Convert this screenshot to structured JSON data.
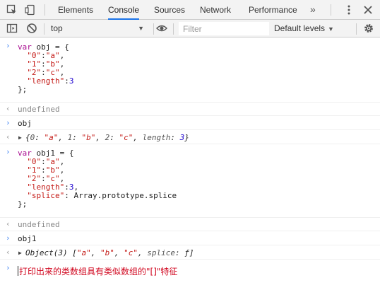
{
  "tabs": {
    "elements": "Elements",
    "console": "Console",
    "sources": "Sources",
    "network": "Network",
    "performance": "Performance",
    "more": "»"
  },
  "toolbar": {
    "context": "top",
    "filter_placeholder": "Filter",
    "levels": "Default levels"
  },
  "entries": {
    "e1": {
      "l1_kw": "var",
      "l1_rest": " obj = {",
      "l2_key": "\"0\"",
      "l2_val": "\"a\"",
      "l3_key": "\"1\"",
      "l3_val": "\"b\"",
      "l4_key": "\"2\"",
      "l4_val": "\"c\"",
      "l5_key": "\"length\"",
      "l5_val": "3",
      "l6": "};"
    },
    "r1": "undefined",
    "e2": "obj",
    "r2": {
      "open": "{",
      "k0": "0",
      "v0": "\"a\"",
      "k1": "1",
      "v1": "\"b\"",
      "k2": "2",
      "v2": "\"c\"",
      "k3": "length",
      "v3": "3",
      "close": "}"
    },
    "e3": {
      "l1_kw": "var",
      "l1_rest": " obj1 = {",
      "l2_key": "\"0\"",
      "l2_val": "\"a\"",
      "l3_key": "\"1\"",
      "l3_val": "\"b\"",
      "l4_key": "\"2\"",
      "l4_val": "\"c\"",
      "l5_key": "\"length\"",
      "l5_val": "3",
      "l6_key": "\"splice\"",
      "l6_val": " Array.prototype.splice",
      "l7": "};"
    },
    "r3": "undefined",
    "e4": "obj1",
    "r4": {
      "prefix": "Object(3) [",
      "a": "\"a\"",
      "b": "\"b\"",
      "c": "\"c\"",
      "splice_key": "splice",
      "splice_val": "ƒ",
      "close": "]"
    }
  },
  "comment": "打印出来的类数组具有类似数组的\"[]\"特征",
  "colors": {
    "keyword": "#aa0d91",
    "string": "#c41a16",
    "number": "#1c00cf",
    "active_tab": "#1a73e8",
    "comment": "#d0021b"
  },
  "icons": [
    "inspect-icon",
    "device-toggle-icon",
    "kebab-menu-icon",
    "close-icon",
    "sidebar-toggle-icon",
    "clear-console-icon",
    "eye-icon",
    "gear-icon"
  ]
}
